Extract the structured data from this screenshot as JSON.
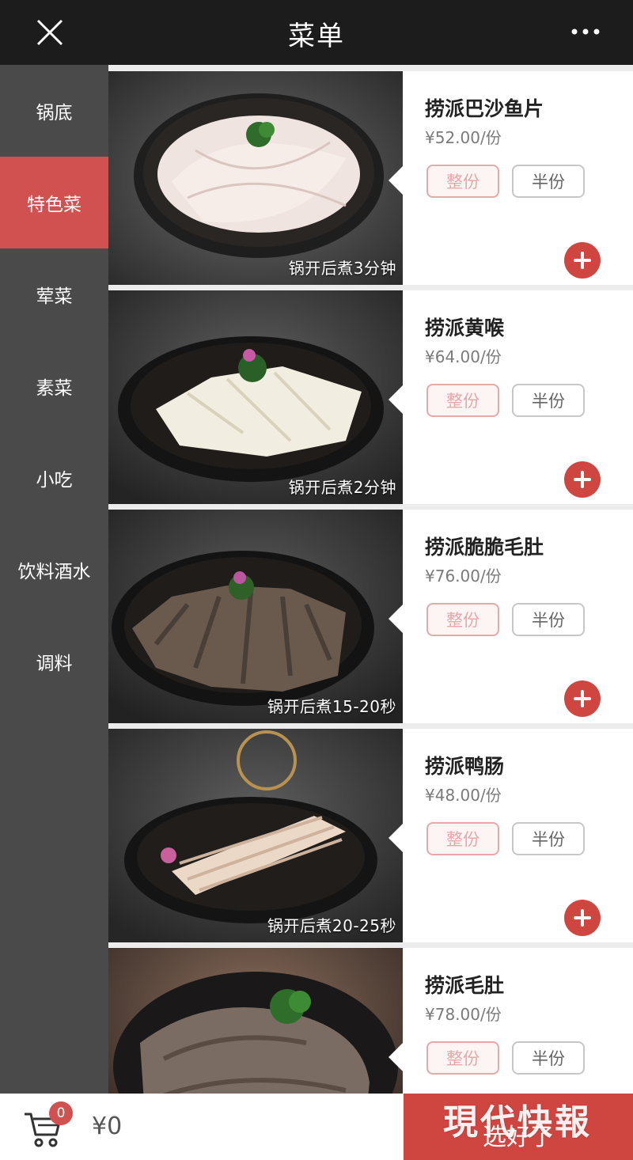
{
  "header": {
    "title": "菜单",
    "close_icon": "close-icon",
    "more_icon": "more-dots-icon"
  },
  "categories": [
    {
      "label": "锅底",
      "active": false
    },
    {
      "label": "特色菜",
      "active": true
    },
    {
      "label": "荤菜",
      "active": false
    },
    {
      "label": "素菜",
      "active": false
    },
    {
      "label": "小吃",
      "active": false
    },
    {
      "label": "饮料酒水",
      "active": false
    },
    {
      "label": "调料",
      "active": false
    }
  ],
  "items": [
    {
      "name": "捞派巴沙鱼片",
      "price": "¥52.00/份",
      "cook_time": "锅开后煮3分钟",
      "full_label": "整份",
      "half_label": "半份"
    },
    {
      "name": "捞派黄喉",
      "price": "¥64.00/份",
      "cook_time": "锅开后煮2分钟",
      "full_label": "整份",
      "half_label": "半份"
    },
    {
      "name": "捞派脆脆毛肚",
      "price": "¥76.00/份",
      "cook_time": "锅开后煮15-20秒",
      "full_label": "整份",
      "half_label": "半份"
    },
    {
      "name": "捞派鸭肠",
      "price": "¥48.00/份",
      "cook_time": "锅开后煮20-25秒",
      "full_label": "整份",
      "half_label": "半份"
    },
    {
      "name": "捞派毛肚",
      "price": "¥78.00/份",
      "cook_time": "",
      "full_label": "整份",
      "half_label": "半份"
    }
  ],
  "cart": {
    "count": "0",
    "total": "¥0",
    "checkout_label": "选好了",
    "icon": "cart-icon"
  },
  "watermark": "現代快報",
  "colors": {
    "accent": "#cf4540",
    "sidebar": "#4a4a4a",
    "topbar": "#1c1c1c"
  }
}
